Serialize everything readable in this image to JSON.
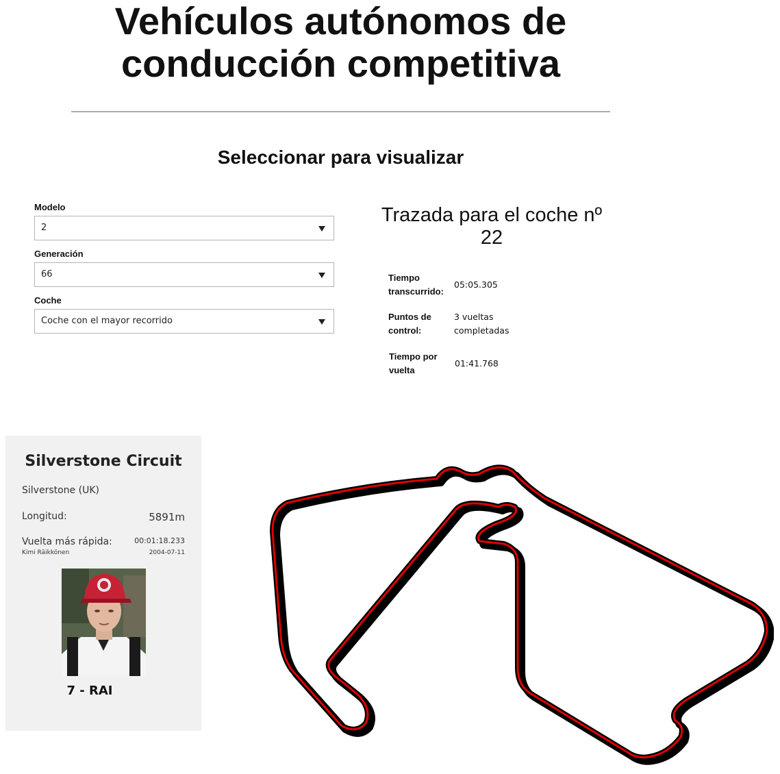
{
  "header": {
    "title": "Vehículos autónomos de conducción competitiva",
    "section_heading": "Seleccionar para visualizar"
  },
  "selectors": {
    "model": {
      "label": "Modelo",
      "value": "2"
    },
    "generation": {
      "label": "Generación",
      "value": "66"
    },
    "car": {
      "label": "Coche",
      "value": "Coche con el mayor recorrido"
    }
  },
  "car_panel": {
    "title": "Trazada para el coche nº 22",
    "stats": [
      {
        "key": "Tiempo transcurrido:",
        "value": "05:05.305"
      },
      {
        "key": "Puntos de control:",
        "value": "3 vueltas completadas"
      },
      {
        "key": "Tiempo por vuelta",
        "value": "01:41.768"
      }
    ]
  },
  "circuit": {
    "name": "Silverstone Circuit",
    "location": "Silverstone (UK)",
    "length_label": "Longitud:",
    "length_value": "5891m",
    "fastest_lap_label": "Vuelta más rápida:",
    "fastest_lap_time": "00:01:18.233",
    "fastest_lap_driver": "Kimi Räikkönen",
    "fastest_lap_date": "2004-07-11",
    "driver_tag": "7 - RAI"
  },
  "colors": {
    "track_line": "#e00000",
    "track_outline": "#000000",
    "card_background": "#f1f1f1"
  }
}
